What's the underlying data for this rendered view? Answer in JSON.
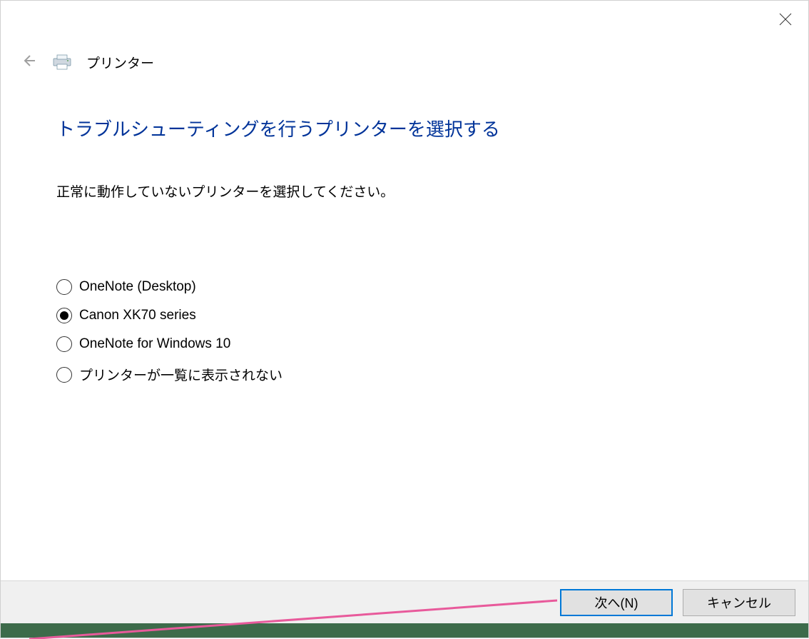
{
  "header": {
    "label": "プリンター"
  },
  "main": {
    "title": "トラブルシューティングを行うプリンターを選択する",
    "subtitle": "正常に動作していないプリンターを選択してください。"
  },
  "options": [
    {
      "label": "OneNote (Desktop)",
      "checked": false
    },
    {
      "label": "Canon XK70 series",
      "checked": true
    },
    {
      "label": "OneNote for Windows 10",
      "checked": false
    },
    {
      "label": "プリンターが一覧に表示されない",
      "checked": false
    }
  ],
  "buttons": {
    "next": "次へ(N)",
    "cancel": "キャンセル"
  }
}
